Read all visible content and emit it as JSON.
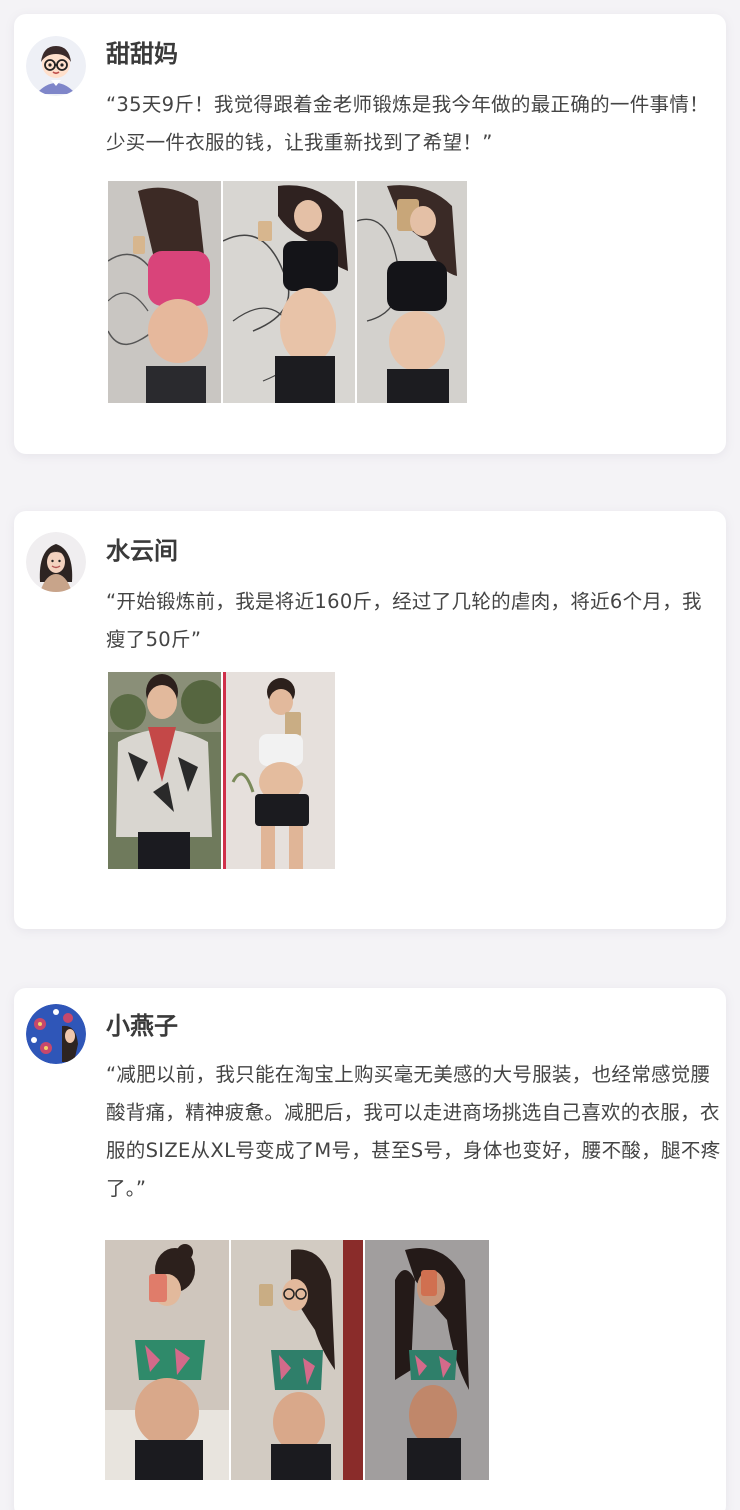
{
  "testimonials": [
    {
      "name": "甜甜妈",
      "quote": "“35天9斤！我觉得跟着金老师锻炼是我今年做的最正确的一件事情！少买一件衣服的钱，让我重新找到了希望！”"
    },
    {
      "name": "水云间",
      "quote": "“开始锻炼前，我是将近160斤，经过了几轮的虐肉，将近6个月，我瘦了50斤”"
    },
    {
      "name": "小燕子",
      "quote": "“减肥以前，我只能在淘宝上购买毫无美感的大号服装，也经常感觉腰酸背痛，精神疲惫。减肥后，我可以走进商场挑选自己喜欢的衣服，衣服的SIZE从XL号变成了M号，甚至S号，身体也变好，腰不酸，腿不疼了。”"
    }
  ],
  "colors": {
    "page_bg": "#f4f3f6",
    "card_bg": "#ffffff",
    "name_text": "#3a3a3a",
    "quote_text": "#444444"
  },
  "icons": [
    "avatar-cartoon-glasses-icon",
    "avatar-woman-illustration-icon",
    "avatar-floral-pattern-icon"
  ]
}
